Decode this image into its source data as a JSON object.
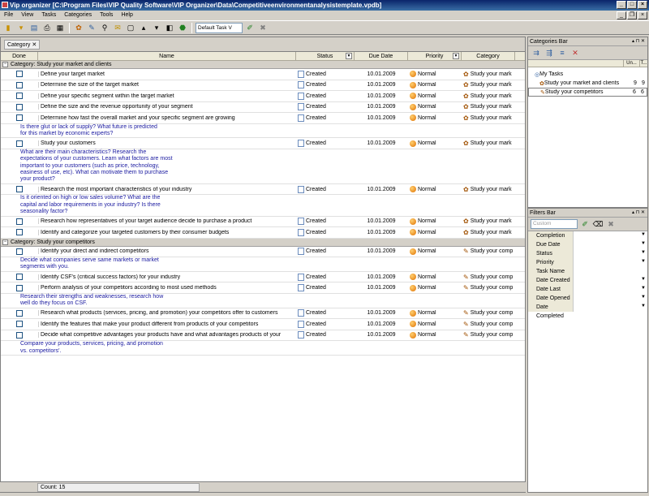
{
  "window": {
    "title": "Vip organizer [C:\\Program Files\\VIP Quality Software\\VIP Organizer\\Data\\Competitiveenvironmentanalysistemplate.vpdb]"
  },
  "menu": [
    "File",
    "View",
    "Tasks",
    "Categories",
    "Tools",
    "Help"
  ],
  "toolbar": {
    "view_select": "Default Task V",
    "icons": [
      "task-icon",
      "new-icon",
      "import-icon",
      "print-icon",
      "print-preview-icon",
      "category-icon",
      "edit-icon",
      "link-icon",
      "notes-icon",
      "attach-icon",
      "move-up-icon",
      "move-down-icon",
      "collapse-icon",
      "expand-icon",
      "filter-icon",
      "tool-icon",
      "delete-icon"
    ]
  },
  "grouping": {
    "tag": "Category"
  },
  "columns": {
    "done": "Done",
    "name": "Name",
    "status": "Status",
    "due": "Due Date",
    "priority": "Priority",
    "category": "Category"
  },
  "groups": [
    {
      "label": "Category: Study your market and clients",
      "rows": [
        {
          "type": "task",
          "name": "Define your target market",
          "status": "Created",
          "due": "10.01.2009",
          "priority": "Normal",
          "category": "Study your mark"
        },
        {
          "type": "task",
          "name": "Determine the size of the target market",
          "status": "Created",
          "due": "10.01.2009",
          "priority": "Normal",
          "category": "Study your mark"
        },
        {
          "type": "task",
          "name": "Define your specific segment within the target market",
          "status": "Created",
          "due": "10.01.2009",
          "priority": "Normal",
          "category": "Study your mark"
        },
        {
          "type": "task",
          "name": "Define the size and the revenue opportunity of your segment",
          "status": "Created",
          "due": "10.01.2009",
          "priority": "Normal",
          "category": "Study your mark"
        },
        {
          "type": "task",
          "name": "Determine how fast the overall market and your specific segment are growing",
          "status": "Created",
          "due": "10.01.2009",
          "priority": "Normal",
          "category": "Study your mark"
        },
        {
          "type": "note",
          "lines": [
            "Is there glut or lack of supply? What future is predicted",
            "for this market by economic experts?"
          ]
        },
        {
          "type": "task",
          "name": "Study your customers",
          "status": "Created",
          "due": "10.01.2009",
          "priority": "Normal",
          "category": "Study your mark"
        },
        {
          "type": "note",
          "lines": [
            "What are their main characteristics? Research the",
            "expectations of your customers. Learn what factors are most",
            "important to your customers (such as price, technology,",
            "easiness of use, etc). What can motivate them to purchase",
            "your product?"
          ]
        },
        {
          "type": "task",
          "name": "Research the most important characteristics of your industry",
          "status": "Created",
          "due": "10.01.2009",
          "priority": "Normal",
          "category": "Study your mark"
        },
        {
          "type": "note",
          "lines": [
            "Is it oriented on high or low sales volume? What are the",
            "capital and labor requirements in your industry? Is there",
            "seasonality factor?"
          ]
        },
        {
          "type": "task",
          "name": "Research how representatives of your target audience decide to purchase a product",
          "status": "Created",
          "due": "10.01.2009",
          "priority": "Normal",
          "category": "Study your mark"
        },
        {
          "type": "task",
          "name": "Identify and categorize your targeted customers by their consumer budgets",
          "status": "Created",
          "due": "10.01.2009",
          "priority": "Normal",
          "category": "Study your mark"
        }
      ]
    },
    {
      "label": "Category: Study your competitors",
      "rows": [
        {
          "type": "task",
          "name": "Identify your direct and indirect competitors",
          "status": "Created",
          "due": "10.01.2009",
          "priority": "Normal",
          "category": "Study your comp"
        },
        {
          "type": "note",
          "lines": [
            "Decide what companies serve same markets or market",
            "segments with you."
          ]
        },
        {
          "type": "task",
          "name": "Identify CSF's (critical success factors) for your industry",
          "status": "Created",
          "due": "10.01.2009",
          "priority": "Normal",
          "category": "Study your comp"
        },
        {
          "type": "task",
          "name": "Perform analysis of your competitors according to most used methods",
          "status": "Created",
          "due": "10.01.2009",
          "priority": "Normal",
          "category": "Study your comp"
        },
        {
          "type": "note",
          "lines": [
            "Research their strengths and weaknesses, research how",
            "well do they focus on CSF."
          ]
        },
        {
          "type": "task",
          "name": "Research what products (services, pricing, and promotion) your competitors offer to customers",
          "status": "Created",
          "due": "10.01.2009",
          "priority": "Normal",
          "category": "Study your comp"
        },
        {
          "type": "task",
          "name": "Identify the features that make your product different from products of your competitors",
          "status": "Created",
          "due": "10.01.2009",
          "priority": "Normal",
          "category": "Study your comp"
        },
        {
          "type": "task",
          "name": "Decide what competitive advantages your products have and what advantages products of your",
          "status": "Created",
          "due": "10.01.2009",
          "priority": "Normal",
          "category": "Study your comp"
        },
        {
          "type": "note",
          "lines": [
            "Compare your products, services, pricing, and promotion",
            "vs. competitors'."
          ]
        }
      ]
    }
  ],
  "status_bar": {
    "count": "Count: 15"
  },
  "categories_bar": {
    "title": "Categories Bar",
    "col1": "Un...",
    "col2": "T...",
    "items": [
      {
        "label": "My Tasks",
        "a": "",
        "b": ""
      },
      {
        "label": "Study your market and clients",
        "a": "9",
        "b": "9"
      },
      {
        "label": "Study your competitors",
        "a": "6",
        "b": "6"
      }
    ]
  },
  "filters_bar": {
    "title": "Filters Bar",
    "select": "Custom",
    "fields": [
      "Completion",
      "Due Date",
      "Status",
      "Priority",
      "Task Name",
      "Date Created",
      "Date Last Modifi",
      "Date Opened",
      "Date Completed"
    ],
    "dropdowns": [
      true,
      true,
      true,
      true,
      false,
      true,
      true,
      true,
      true
    ]
  }
}
